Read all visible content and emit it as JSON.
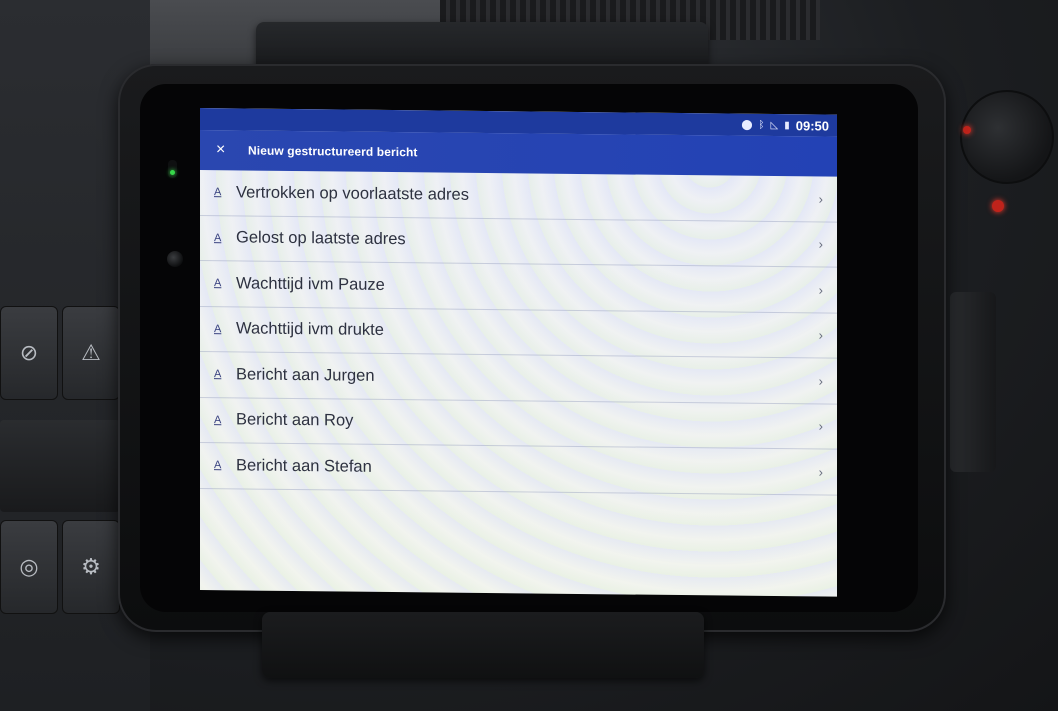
{
  "status_bar": {
    "icons": [
      "location-icon",
      "bluetooth-icon",
      "signal-icon",
      "battery-icon"
    ],
    "time": "09:50"
  },
  "app_bar": {
    "close_icon": "×",
    "title": "Nieuw gestructureerd bericht"
  },
  "list": {
    "items": [
      {
        "label": "Vertrokken op voorlaatste adres"
      },
      {
        "label": "Gelost op laatste adres"
      },
      {
        "label": "Wachttijd ivm Pauze"
      },
      {
        "label": "Wachttijd ivm drukte"
      },
      {
        "label": "Bericht aan Jurgen"
      },
      {
        "label": "Bericht aan Roy"
      },
      {
        "label": "Bericht aan Stefan"
      }
    ],
    "item_icon": "A",
    "chevron": "›"
  },
  "colors": {
    "status_bar": "#1e3a9e",
    "app_bar": "#2a47b0",
    "status_led": "#37d84a",
    "red_led": "#c0231b"
  }
}
